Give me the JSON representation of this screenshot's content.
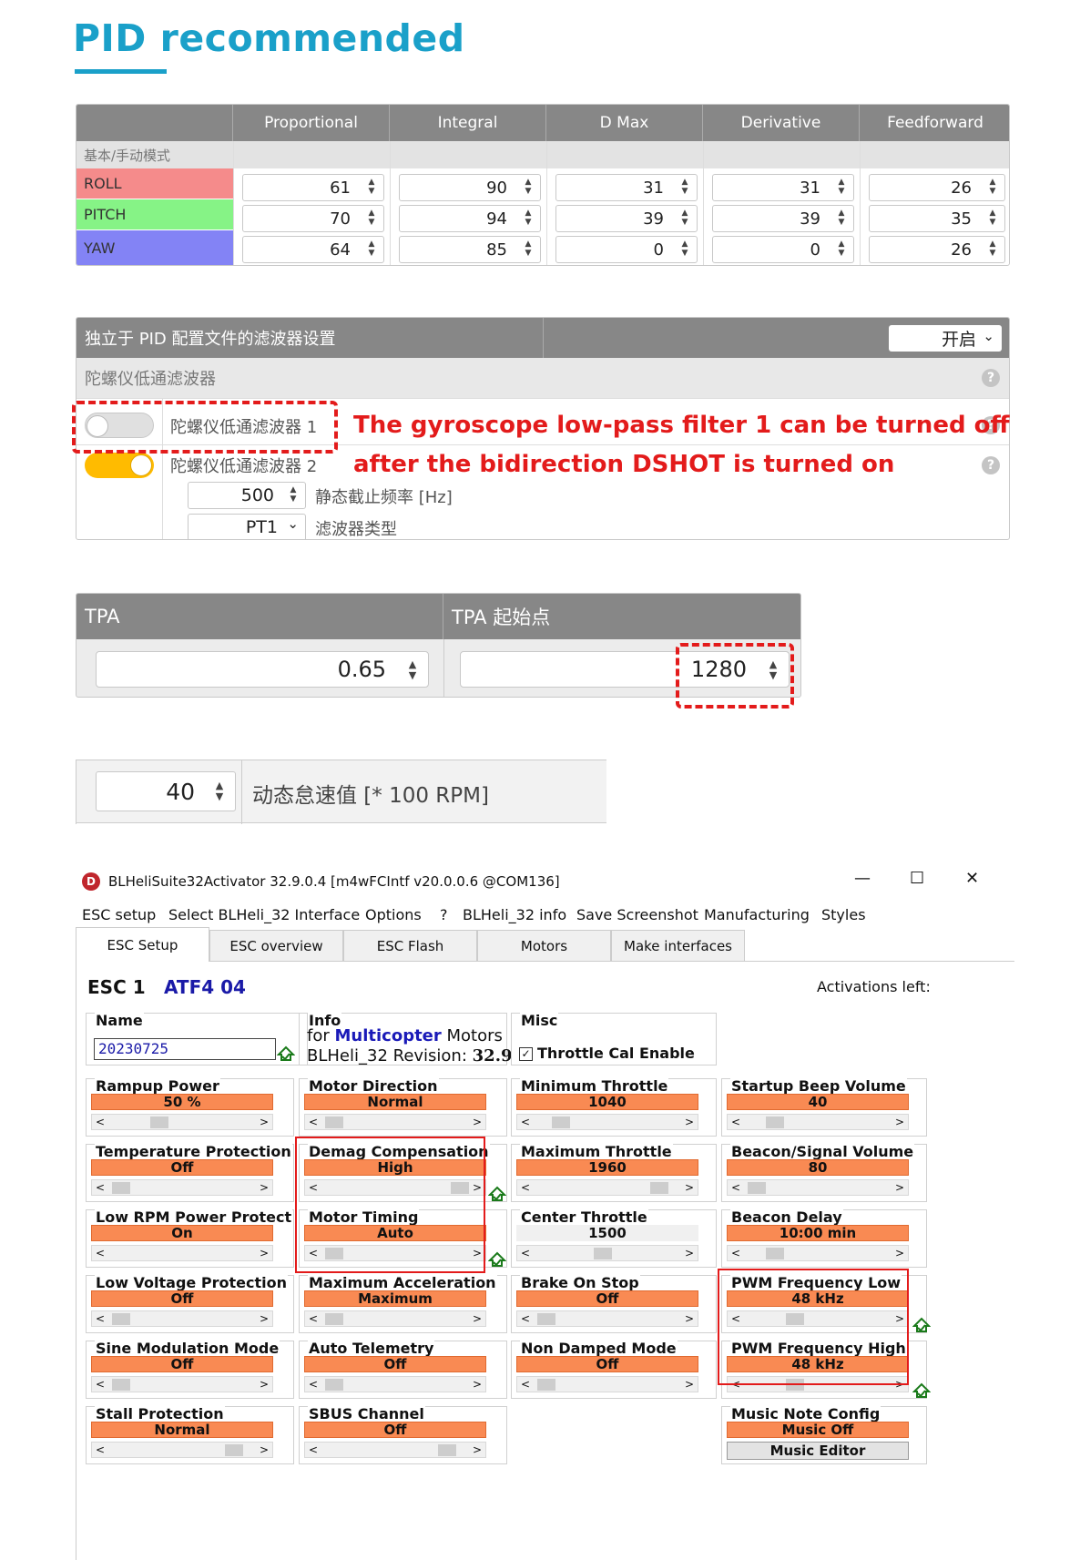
{
  "title": "PID recommended",
  "pid": {
    "headers": [
      "Proportional",
      "Integral",
      "D Max",
      "Derivative",
      "Feedforward"
    ],
    "mode_label": "基本/手动模式",
    "rows": [
      {
        "label": "ROLL",
        "color": "#f58b8b",
        "values": [
          "61",
          "90",
          "31",
          "31",
          "26"
        ]
      },
      {
        "label": "PITCH",
        "color": "#86f386",
        "values": [
          "70",
          "94",
          "39",
          "39",
          "35"
        ]
      },
      {
        "label": "YAW",
        "color": "#8383f5",
        "values": [
          "64",
          "85",
          "0",
          "0",
          "26"
        ]
      }
    ]
  },
  "filter": {
    "header": "独立于 PID 配置文件的滤波器设置",
    "header_select": "开启",
    "subheader": "陀螺仪低通滤波器",
    "lpf1_label": "陀螺仪低通滤波器 1",
    "lpf2_label": "陀螺仪低通滤波器 2",
    "cutoff_value": "500",
    "cutoff_label": "静态截止频率 [Hz]",
    "type_value": "PT1",
    "type_label": "滤波器类型",
    "annotation_line1": "The gyroscope low-pass filter 1 can be turned off",
    "annotation_line2": "after the bidirection DSHOT is turned on",
    "toggle_on_color": "#ffbb00",
    "help_glyph": "?"
  },
  "tpa": {
    "label": "TPA",
    "value": "0.65",
    "breakpoint_label": "TPA 起始点",
    "breakpoint_value": "1280"
  },
  "idle": {
    "value": "40",
    "label": "动态怠速值 [* 100 RPM]"
  },
  "blheli": {
    "window_title": "BLHeliSuite32Activator 32.9.0.4  [m4wFCIntf v20.0.0.6 @COM136]",
    "window_controls": {
      "minimize": "—",
      "maximize": "☐",
      "close": "✕"
    },
    "menu": [
      "ESC setup",
      "Select BLHeli_32 Interface",
      "Options",
      "?",
      "BLHeli_32 info",
      "Save Screenshot",
      "Manufacturing",
      "Styles"
    ],
    "tabs": [
      "ESC Setup",
      "ESC overview",
      "ESC Flash",
      "Motors",
      "Make interfaces"
    ],
    "esc_label": "ESC 1",
    "esc_model": "ATF4 04",
    "activations": "Activations left:",
    "name_title": "Name",
    "name_value": "20230725",
    "info_title": "Info",
    "info_for": "for",
    "info_multicopter": "Multicopter",
    "info_motors": "Motors",
    "info_revision_label": "BLHeli_32 Revision:",
    "info_revision_value": "32.9",
    "misc_title": "Misc",
    "misc_checkbox": "Throttle Cal Enable",
    "accent_color": "#f98a53",
    "params": {
      "rampup_title": "Rampup Power",
      "rampup": "50 %",
      "motor_dir_title": "Motor Direction",
      "motor_dir": "Normal",
      "min_throttle_title": "Minimum Throttle",
      "min_throttle": "1040",
      "startup_beep_title": "Startup Beep Volume",
      "startup_beep": "40",
      "temp_prot_title": "Temperature Protection",
      "temp_prot": "Off",
      "demag_title": "Demag Compensation",
      "demag": "High",
      "max_throttle_title": "Maximum Throttle",
      "max_throttle": "1960",
      "beacon_vol_title": "Beacon/Signal Volume",
      "beacon_vol": "80",
      "low_rpm_title": "Low RPM Power Protect",
      "low_rpm": "On",
      "timing_title": "Motor Timing",
      "timing": "Auto",
      "center_throttle_title": "Center Throttle",
      "center_throttle": "1500",
      "beacon_delay_title": "Beacon Delay",
      "beacon_delay": "10:00 min",
      "low_volt_title": "Low Voltage Protection",
      "low_volt": "Off",
      "max_accel_title": "Maximum Acceleration",
      "max_accel": "Maximum",
      "brake_title": "Brake On Stop",
      "brake": "Off",
      "pwm_low_title": "PWM Frequency Low",
      "pwm_low": "48 kHz",
      "sine_title": "Sine Modulation Mode",
      "sine": "Off",
      "telemetry_title": "Auto Telemetry",
      "telemetry": "Off",
      "non_damped_title": "Non Damped Mode",
      "non_damped": "Off",
      "pwm_high_title": "PWM Frequency High",
      "pwm_high": "48 kHz",
      "stall_title": "Stall Protection",
      "stall": "Normal",
      "sbus_title": "SBUS Channel",
      "sbus": "Off",
      "music_title": "Music Note Config",
      "music": "Music Off",
      "music_editor": "Music Editor"
    }
  }
}
